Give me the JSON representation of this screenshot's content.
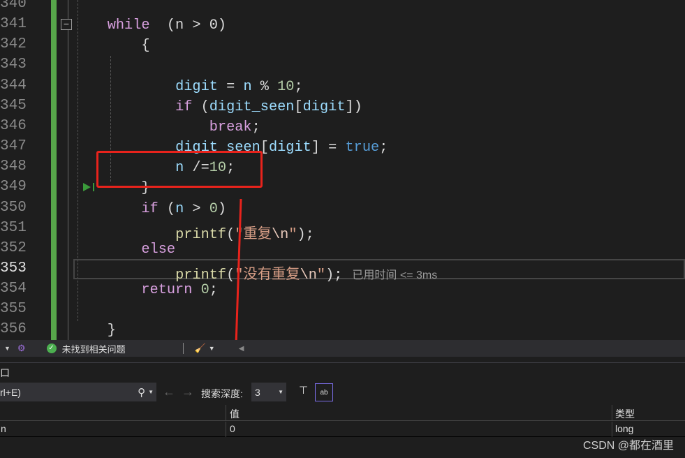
{
  "editor": {
    "current_line": "353",
    "lines": [
      {
        "n": "340",
        "t": []
      },
      {
        "n": "341",
        "t": [
          [
            "kw",
            "while"
          ],
          [
            "",
            "  (n > 0)"
          ]
        ]
      },
      {
        "n": "342",
        "t": [
          [
            "",
            "    {"
          ]
        ]
      },
      {
        "n": "343",
        "t": []
      },
      {
        "n": "344",
        "t": [
          [
            "",
            "        "
          ],
          [
            "var",
            "digit"
          ],
          [
            "",
            " = "
          ],
          [
            "var",
            "n"
          ],
          [
            "",
            " % "
          ],
          [
            "num",
            "10"
          ],
          [
            "",
            ";"
          ]
        ]
      },
      {
        "n": "345",
        "t": [
          [
            "",
            "        "
          ],
          [
            "kw",
            "if"
          ],
          [
            "",
            " ("
          ],
          [
            "var",
            "digit_seen"
          ],
          [
            "",
            "["
          ],
          [
            "var",
            "digit"
          ],
          [
            "",
            "])"
          ]
        ]
      },
      {
        "n": "346",
        "t": [
          [
            "",
            "            "
          ],
          [
            "kw",
            "break"
          ],
          [
            "",
            ";"
          ]
        ]
      },
      {
        "n": "347",
        "t": [
          [
            "",
            "        "
          ],
          [
            "var",
            "digit_seen"
          ],
          [
            "",
            "["
          ],
          [
            "var",
            "digit"
          ],
          [
            "",
            "] = "
          ],
          [
            "bl",
            "true"
          ],
          [
            "",
            ";"
          ]
        ]
      },
      {
        "n": "348",
        "t": [
          [
            "",
            "        "
          ],
          [
            "var",
            "n"
          ],
          [
            "",
            " /="
          ],
          [
            "num",
            "10"
          ],
          [
            "",
            ";"
          ]
        ]
      },
      {
        "n": "349",
        "t": [
          [
            "",
            "    }"
          ]
        ]
      },
      {
        "n": "350",
        "t": [
          [
            "",
            "    "
          ],
          [
            "kw",
            "if"
          ],
          [
            "",
            " ("
          ],
          [
            "var",
            "n"
          ],
          [
            "",
            " > "
          ],
          [
            "num",
            "0"
          ],
          [
            "",
            ")"
          ]
        ]
      },
      {
        "n": "351",
        "t": [
          [
            "",
            "        "
          ],
          [
            "fn",
            "printf"
          ],
          [
            "",
            "("
          ],
          [
            "str",
            "\"重复"
          ],
          [
            "esc",
            "\\n"
          ],
          [
            "str",
            "\""
          ],
          [
            "",
            ");"
          ]
        ]
      },
      {
        "n": "352",
        "t": [
          [
            "",
            "    "
          ],
          [
            "kw",
            "else"
          ]
        ]
      },
      {
        "n": "353",
        "t": [
          [
            "",
            "        "
          ],
          [
            "fn",
            "printf"
          ],
          [
            "",
            "("
          ],
          [
            "str",
            "\"没有重复"
          ],
          [
            "esc",
            "\\n"
          ],
          [
            "str",
            "\""
          ],
          [
            "",
            ");"
          ]
        ]
      },
      {
        "n": "354",
        "t": [
          [
            "",
            "    "
          ],
          [
            "kw",
            "return"
          ],
          [
            "",
            " "
          ],
          [
            "num",
            "0"
          ],
          [
            "",
            ";"
          ]
        ]
      },
      {
        "n": "355",
        "t": []
      },
      {
        "n": "356",
        "t": [
          [
            "",
            "}"
          ]
        ]
      }
    ],
    "elapsed_hint": "已用时间 <= 3ms"
  },
  "statusbar": {
    "issues_label": "未找到相关问题"
  },
  "panel": {
    "title_fragment": "口",
    "search_placeholder_fragment": "rl+E)",
    "search_depth_label": "搜索深度:",
    "search_depth_value": "3",
    "columns": [
      "",
      "值",
      "类型"
    ],
    "rows": [
      {
        "name": "n",
        "value": "0",
        "type": "long"
      }
    ]
  },
  "watermark": "CSDN @都在酒里",
  "colors": {
    "annotation": "#e8231c",
    "accent_green": "#57a64a"
  }
}
